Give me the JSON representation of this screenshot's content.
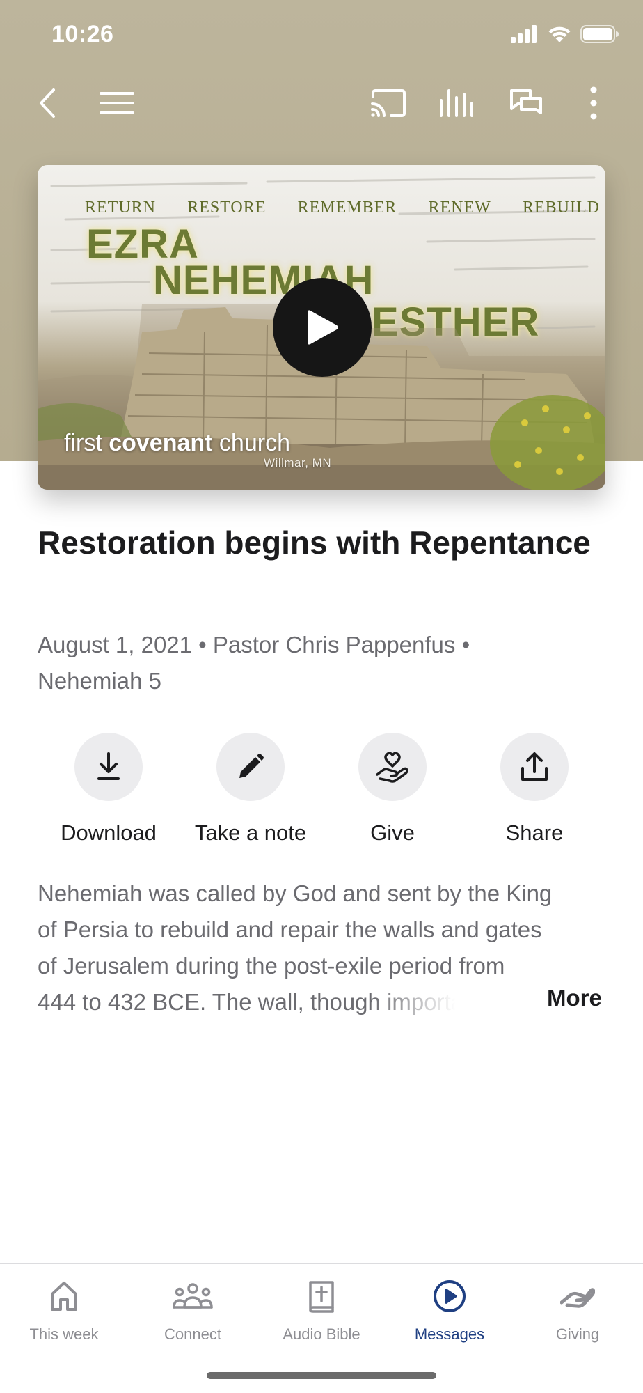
{
  "status_bar": {
    "time": "10:26"
  },
  "top_nav": {
    "back_icon": "chevron-left-icon",
    "menu_icon": "hamburger-menu-icon",
    "cast_icon": "cast-icon",
    "audio_icon": "audio-bars-icon",
    "chat_icon": "chat-bubbles-icon",
    "more_icon": "vertical-dots-icon"
  },
  "video": {
    "theme_words": [
      "RETURN",
      "RESTORE",
      "REMEMBER",
      "RENEW",
      "REBUILD"
    ],
    "book_titles": [
      "EZRA",
      "NEHEMIAH",
      "ESTHER"
    ],
    "brand_light_1": "first ",
    "brand_bold": "covenant",
    "brand_light_2": " church",
    "brand_location": "Willmar, MN",
    "play_icon": "play-icon"
  },
  "message": {
    "title": "Restoration begins with Repentance",
    "meta_line1": "August 1, 2021 • Pastor Chris Pappenfus •",
    "meta_line2": "Nehemiah 5"
  },
  "actions": [
    {
      "label": "Download",
      "icon": "download-icon"
    },
    {
      "label": "Take a note",
      "icon": "pencil-icon"
    },
    {
      "label": "Give",
      "icon": "give-heart-hand-icon"
    },
    {
      "label": "Share",
      "icon": "share-icon"
    }
  ],
  "description": {
    "line1": "Nehemiah was called by God and sent by the King",
    "line2": "of Persia to rebuild and repair the walls and gates",
    "line3": "of Jerusalem during the post-exile period from",
    "line4": "444 to 432 BCE.  The wall, though importan",
    "more_label": "More"
  },
  "tab_bar": {
    "tabs": [
      {
        "label": "This week",
        "icon": "home-icon"
      },
      {
        "label": "Connect",
        "icon": "people-group-icon"
      },
      {
        "label": "Audio Bible",
        "icon": "bible-icon"
      },
      {
        "label": "Messages",
        "icon": "play-circle-icon",
        "active": true
      },
      {
        "label": "Giving",
        "icon": "giving-hand-icon"
      }
    ],
    "active_color": "#1f3f82",
    "inactive_color": "#8e8e93"
  }
}
